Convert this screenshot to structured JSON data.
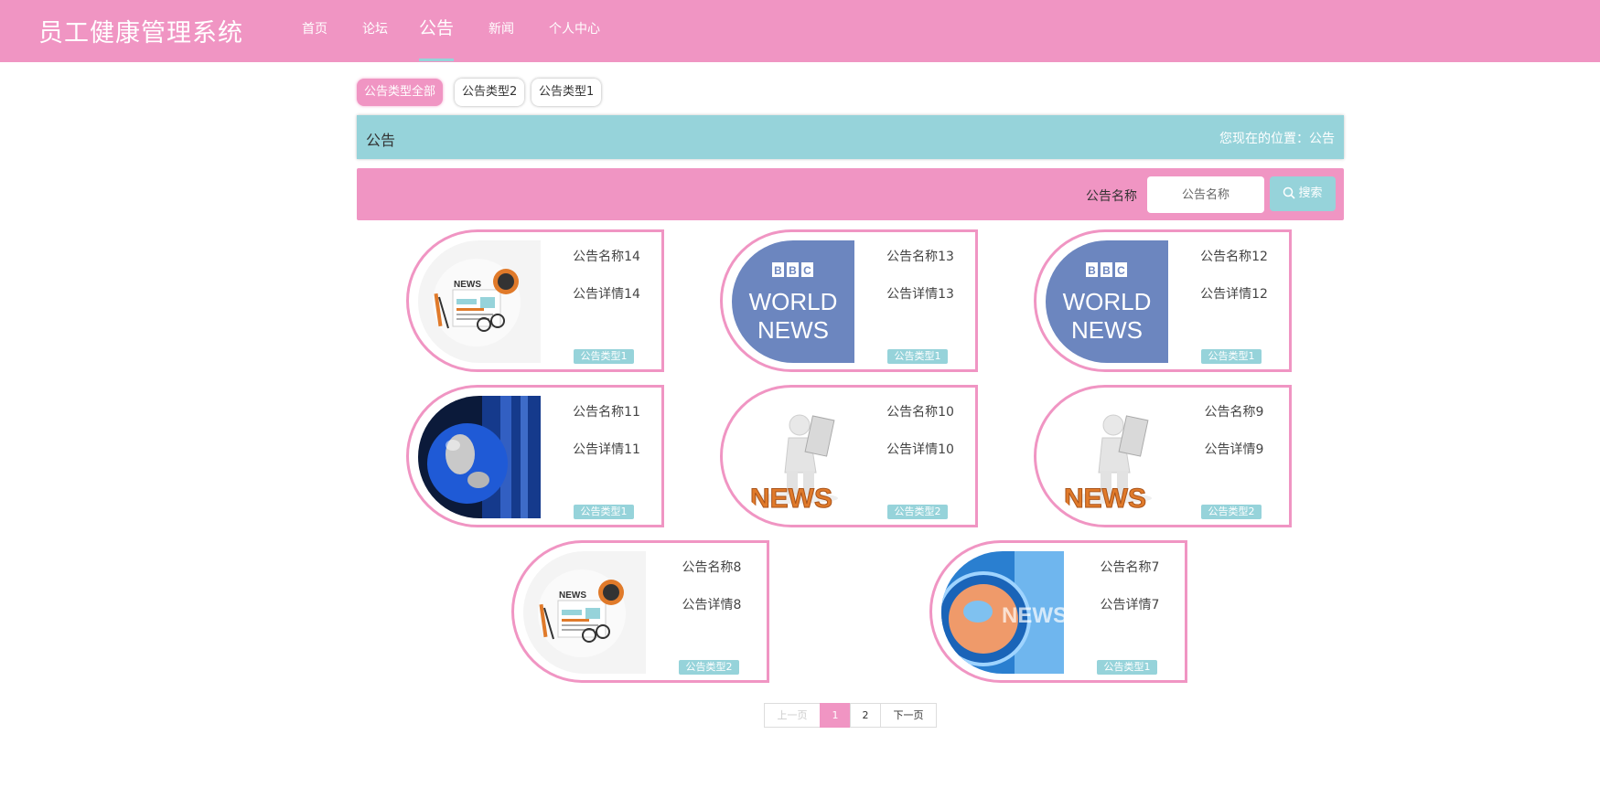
{
  "header": {
    "brand": "员工健康管理系统",
    "nav": [
      "首页",
      "论坛",
      "公告",
      "新闻",
      "个人中心"
    ],
    "active_index": 2
  },
  "filters": [
    "公告类型全部",
    "公告类型2",
    "公告类型1"
  ],
  "title_bar": {
    "title": "公告",
    "location": "您现在的位置：公告"
  },
  "search": {
    "label": "公告名称",
    "placeholder": "公告名称",
    "button": "搜索"
  },
  "cards": [
    {
      "name": "公告名称14",
      "detail": "公告详情14",
      "type": "公告类型1",
      "image": "news-paper-icon"
    },
    {
      "name": "公告名称13",
      "detail": "公告详情13",
      "type": "公告类型1",
      "image": "bbc-world-news-logo"
    },
    {
      "name": "公告名称12",
      "detail": "公告详情12",
      "type": "公告类型1",
      "image": "bbc-world-news-logo"
    },
    {
      "name": "公告名称11",
      "detail": "公告详情11",
      "type": "公告类型1",
      "image": "globe-news-image"
    },
    {
      "name": "公告名称10",
      "detail": "公告详情10",
      "type": "公告类型2",
      "image": "man-reading-news-3d"
    },
    {
      "name": "公告名称9",
      "detail": "公告详情9",
      "type": "公告类型2",
      "image": "man-reading-news-3d"
    },
    {
      "name": "公告名称8",
      "detail": "公告详情8",
      "type": "公告类型2",
      "image": "news-paper-icon"
    },
    {
      "name": "公告名称7",
      "detail": "公告详情7",
      "type": "公告类型1",
      "image": "blue-globe-news"
    }
  ],
  "images": {
    "bbc_letters": [
      "B",
      "B",
      "C"
    ],
    "bbc_world": "WORLD",
    "bbc_news": "NEWS",
    "news_word": "NEWS"
  },
  "pagination": {
    "prev": "上一页",
    "pages": [
      "1",
      "2"
    ],
    "current": "1",
    "next": "下一页"
  },
  "colors": {
    "pink": "#f095c3",
    "teal": "#96d3da",
    "bbc_blue": "#6c86bf",
    "news_orange": "#e07a2a"
  }
}
